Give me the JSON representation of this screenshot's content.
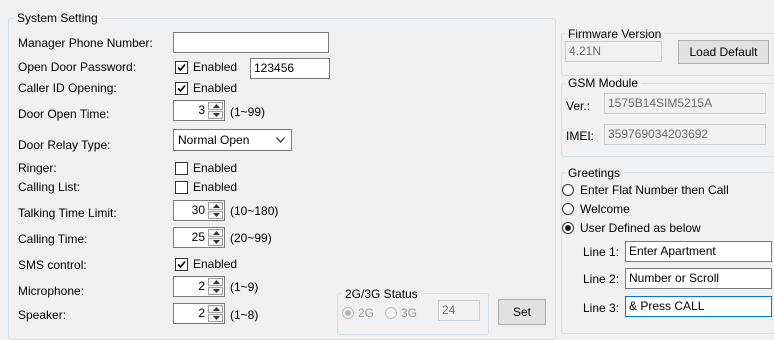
{
  "system_setting": {
    "title": "System Setting",
    "manager_phone": {
      "label": "Manager Phone Number:",
      "value": ""
    },
    "open_door_password": {
      "label": "Open Door Password:",
      "checked": true,
      "check_label": "Enabled",
      "value": "123456"
    },
    "caller_id_opening": {
      "label": "Caller ID Opening:",
      "checked": true,
      "check_label": "Enabled"
    },
    "door_open_time": {
      "label": "Door Open Time:",
      "value": "3",
      "range": "(1~99)"
    },
    "door_relay_type": {
      "label": "Door Relay Type:",
      "value": "Normal Open"
    },
    "ringer": {
      "label": "Ringer:",
      "checked": false,
      "check_label": "Enabled"
    },
    "calling_list": {
      "label": "Calling List:",
      "checked": false,
      "check_label": "Enabled"
    },
    "talking_time_limit": {
      "label": "Talking Time Limit:",
      "value": "30",
      "range": "(10~180)"
    },
    "calling_time": {
      "label": "Calling Time:",
      "value": "25",
      "range": "(20~99)"
    },
    "sms_control": {
      "label": "SMS control:",
      "checked": true,
      "check_label": "Enabled"
    },
    "microphone": {
      "label": "Microphone:",
      "value": "2",
      "range": "(1~9)"
    },
    "speaker": {
      "label": "Speaker:",
      "value": "2",
      "range": "(1~8)"
    }
  },
  "network_status": {
    "title": "2G/3G Status",
    "option_2g": "2G",
    "option_3g": "3G",
    "selected": "2G",
    "value": "24",
    "set_button": "Set"
  },
  "firmware": {
    "title": "Firmware Version",
    "version": "4.21N",
    "load_default_button": "Load Default"
  },
  "gsm_module": {
    "title": "GSM Module",
    "ver_label": "Ver.:",
    "ver_value": "1575B14SIM5215A",
    "imei_label": "IMEI:",
    "imei_value": "359769034203692"
  },
  "greetings": {
    "title": "Greetings",
    "options": [
      "Enter Flat Number then Call",
      "Welcome",
      "User Defined as below"
    ],
    "selected_index": 2,
    "lines": [
      {
        "label": "Line 1:",
        "value": "Enter Apartment"
      },
      {
        "label": "Line 2:",
        "value": "Number or Scroll"
      },
      {
        "label": "Line 3:",
        "value": "& Press CALL"
      }
    ]
  }
}
